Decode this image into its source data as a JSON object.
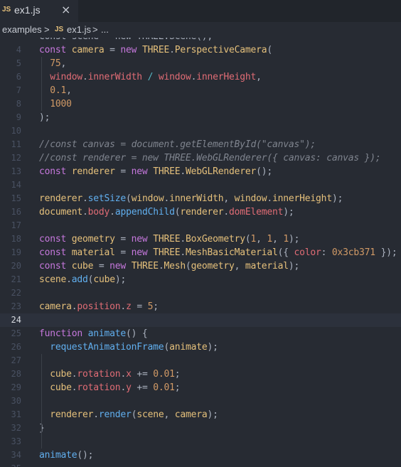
{
  "tab": {
    "lang_badge": "JS",
    "filename": "ex1.js",
    "close_glyph": "×"
  },
  "breadcrumb": {
    "folder": "examples",
    "sep": ">",
    "file_badge": "JS",
    "file": "ex1.js",
    "sep2": ">",
    "more": "..."
  },
  "editor": {
    "cursor_line": 24,
    "lines": [
      {
        "n": "",
        "segs": [
          [
            "p",
            "const scene = new THREE.Scene();"
          ]
        ]
      },
      {
        "n": "4",
        "segs": [
          [
            "k",
            "const "
          ],
          [
            "t",
            "camera"
          ],
          [
            "p",
            " = "
          ],
          [
            "k",
            "new "
          ],
          [
            "t",
            "THREE"
          ],
          [
            "p",
            "."
          ],
          [
            "t",
            "PerspectiveCamera"
          ],
          [
            "p",
            "("
          ]
        ]
      },
      {
        "n": "5",
        "segs": [
          [
            "p",
            "  "
          ],
          [
            "n",
            "75"
          ],
          [
            "p",
            ","
          ]
        ]
      },
      {
        "n": "6",
        "segs": [
          [
            "p",
            "  "
          ],
          [
            "v",
            "window"
          ],
          [
            "p",
            "."
          ],
          [
            "v",
            "innerWidth"
          ],
          [
            "o",
            " / "
          ],
          [
            "v",
            "window"
          ],
          [
            "p",
            "."
          ],
          [
            "v",
            "innerHeight"
          ],
          [
            "p",
            ","
          ]
        ]
      },
      {
        "n": "7",
        "segs": [
          [
            "p",
            "  "
          ],
          [
            "n",
            "0.1"
          ],
          [
            "p",
            ","
          ]
        ]
      },
      {
        "n": "8",
        "segs": [
          [
            "p",
            "  "
          ],
          [
            "n",
            "1000"
          ]
        ]
      },
      {
        "n": "9",
        "segs": [
          [
            "p",
            ");"
          ]
        ]
      },
      {
        "n": "10",
        "segs": []
      },
      {
        "n": "11",
        "segs": [
          [
            "c",
            "//const canvas = document.getElementById(\"canvas\");"
          ]
        ]
      },
      {
        "n": "12",
        "segs": [
          [
            "c",
            "//const renderer = new THREE.WebGLRenderer({ canvas: canvas });"
          ]
        ]
      },
      {
        "n": "13",
        "segs": [
          [
            "k",
            "const "
          ],
          [
            "t",
            "renderer"
          ],
          [
            "p",
            " = "
          ],
          [
            "k",
            "new "
          ],
          [
            "t",
            "THREE"
          ],
          [
            "p",
            "."
          ],
          [
            "t",
            "WebGLRenderer"
          ],
          [
            "p",
            "();"
          ]
        ]
      },
      {
        "n": "14",
        "segs": []
      },
      {
        "n": "15",
        "segs": [
          [
            "t",
            "renderer"
          ],
          [
            "p",
            "."
          ],
          [
            "f",
            "setSize"
          ],
          [
            "p",
            "("
          ],
          [
            "t",
            "window"
          ],
          [
            "p",
            "."
          ],
          [
            "t",
            "innerWidth"
          ],
          [
            "p",
            ", "
          ],
          [
            "t",
            "window"
          ],
          [
            "p",
            "."
          ],
          [
            "t",
            "innerHeight"
          ],
          [
            "p",
            ");"
          ]
        ]
      },
      {
        "n": "16",
        "segs": [
          [
            "t",
            "document"
          ],
          [
            "p",
            "."
          ],
          [
            "v",
            "body"
          ],
          [
            "p",
            "."
          ],
          [
            "f",
            "appendChild"
          ],
          [
            "p",
            "("
          ],
          [
            "t",
            "renderer"
          ],
          [
            "p",
            "."
          ],
          [
            "v",
            "domElement"
          ],
          [
            "p",
            ");"
          ]
        ]
      },
      {
        "n": "17",
        "segs": []
      },
      {
        "n": "18",
        "segs": [
          [
            "k",
            "const "
          ],
          [
            "t",
            "geometry"
          ],
          [
            "p",
            " = "
          ],
          [
            "k",
            "new "
          ],
          [
            "t",
            "THREE"
          ],
          [
            "p",
            "."
          ],
          [
            "t",
            "BoxGeometry"
          ],
          [
            "p",
            "("
          ],
          [
            "n",
            "1"
          ],
          [
            "p",
            ", "
          ],
          [
            "n",
            "1"
          ],
          [
            "p",
            ", "
          ],
          [
            "n",
            "1"
          ],
          [
            "p",
            ");"
          ]
        ]
      },
      {
        "n": "19",
        "segs": [
          [
            "k",
            "const "
          ],
          [
            "t",
            "material"
          ],
          [
            "p",
            " = "
          ],
          [
            "k",
            "new "
          ],
          [
            "t",
            "THREE"
          ],
          [
            "p",
            "."
          ],
          [
            "t",
            "MeshBasicMaterial"
          ],
          [
            "p",
            "({ "
          ],
          [
            "v",
            "color"
          ],
          [
            "p",
            ": "
          ],
          [
            "n",
            "0x3cb371"
          ],
          [
            "p",
            " });"
          ]
        ]
      },
      {
        "n": "20",
        "segs": [
          [
            "k",
            "const "
          ],
          [
            "t",
            "cube"
          ],
          [
            "p",
            " = "
          ],
          [
            "k",
            "new "
          ],
          [
            "t",
            "THREE"
          ],
          [
            "p",
            "."
          ],
          [
            "t",
            "Mesh"
          ],
          [
            "p",
            "("
          ],
          [
            "t",
            "geometry"
          ],
          [
            "p",
            ", "
          ],
          [
            "t",
            "material"
          ],
          [
            "p",
            ");"
          ]
        ]
      },
      {
        "n": "21",
        "segs": [
          [
            "t",
            "scene"
          ],
          [
            "p",
            "."
          ],
          [
            "f",
            "add"
          ],
          [
            "p",
            "("
          ],
          [
            "t",
            "cube"
          ],
          [
            "p",
            ");"
          ]
        ]
      },
      {
        "n": "22",
        "segs": []
      },
      {
        "n": "23",
        "segs": [
          [
            "t",
            "camera"
          ],
          [
            "p",
            "."
          ],
          [
            "v",
            "position"
          ],
          [
            "p",
            "."
          ],
          [
            "v",
            "z"
          ],
          [
            "p",
            " = "
          ],
          [
            "n",
            "5"
          ],
          [
            "p",
            ";"
          ]
        ]
      },
      {
        "n": "24",
        "segs": []
      },
      {
        "n": "25",
        "segs": [
          [
            "k",
            "function "
          ],
          [
            "f",
            "animate"
          ],
          [
            "p",
            "() {"
          ]
        ]
      },
      {
        "n": "26",
        "segs": [
          [
            "p",
            "  "
          ],
          [
            "f",
            "requestAnimationFrame"
          ],
          [
            "p",
            "("
          ],
          [
            "t",
            "animate"
          ],
          [
            "p",
            ");"
          ]
        ]
      },
      {
        "n": "27",
        "segs": []
      },
      {
        "n": "28",
        "segs": [
          [
            "p",
            "  "
          ],
          [
            "t",
            "cube"
          ],
          [
            "p",
            "."
          ],
          [
            "v",
            "rotation"
          ],
          [
            "p",
            "."
          ],
          [
            "v",
            "x"
          ],
          [
            "p",
            " += "
          ],
          [
            "n",
            "0.01"
          ],
          [
            "p",
            ";"
          ]
        ]
      },
      {
        "n": "29",
        "segs": [
          [
            "p",
            "  "
          ],
          [
            "t",
            "cube"
          ],
          [
            "p",
            "."
          ],
          [
            "v",
            "rotation"
          ],
          [
            "p",
            "."
          ],
          [
            "v",
            "y"
          ],
          [
            "p",
            " += "
          ],
          [
            "n",
            "0.01"
          ],
          [
            "p",
            ";"
          ]
        ]
      },
      {
        "n": "30",
        "segs": []
      },
      {
        "n": "31",
        "segs": [
          [
            "p",
            "  "
          ],
          [
            "t",
            "renderer"
          ],
          [
            "p",
            "."
          ],
          [
            "f",
            "render"
          ],
          [
            "p",
            "("
          ],
          [
            "t",
            "scene"
          ],
          [
            "p",
            ", "
          ],
          [
            "t",
            "camera"
          ],
          [
            "p",
            ");"
          ]
        ]
      },
      {
        "n": "32",
        "segs": [
          [
            "p",
            "}"
          ]
        ]
      },
      {
        "n": "33",
        "segs": []
      },
      {
        "n": "34",
        "segs": [
          [
            "f",
            "animate"
          ],
          [
            "p",
            "();"
          ]
        ]
      },
      {
        "n": "35",
        "segs": []
      }
    ]
  }
}
